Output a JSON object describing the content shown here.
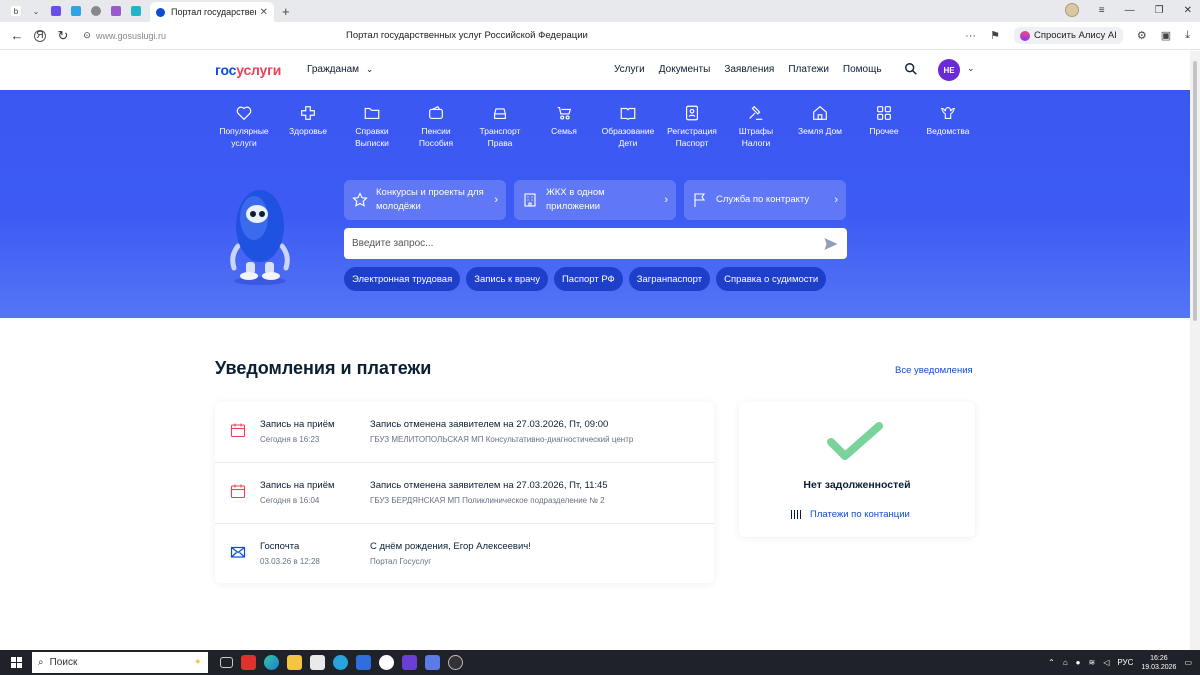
{
  "browser": {
    "active_tab_title": "Портал государственн",
    "url": "www.gosuslugi.ru",
    "page_title": "Портал государственных услуг Российской Федерации",
    "alice_label": "Спросить Алису AI",
    "more_dots": "···"
  },
  "header": {
    "logo_part1": "гос",
    "logo_part2": "услуги",
    "persona": "Гражданам",
    "nav": [
      "Услуги",
      "Документы",
      "Заявления",
      "Платежи",
      "Помощь"
    ],
    "avatar_initials": "НЕ"
  },
  "categories": [
    {
      "label": "Популярные услуги",
      "icon": "heart-icon"
    },
    {
      "label": "Здоровье",
      "icon": "health-cross-icon"
    },
    {
      "label": "Справки Выписки",
      "icon": "folder-icon"
    },
    {
      "label": "Пенсии Пособия",
      "icon": "wallet-icon"
    },
    {
      "label": "Транспорт Права",
      "icon": "car-icon"
    },
    {
      "label": "Семья",
      "icon": "stroller-icon"
    },
    {
      "label": "Образование Дети",
      "icon": "book-icon"
    },
    {
      "label": "Регистрация Паспорт",
      "icon": "id-card-icon"
    },
    {
      "label": "Штрафы Налоги",
      "icon": "gavel-icon"
    },
    {
      "label": "Земля Дом",
      "icon": "house-icon"
    },
    {
      "label": "Прочее",
      "icon": "grid-icon"
    },
    {
      "label": "Ведомства",
      "icon": "emblem-icon"
    }
  ],
  "promos": [
    {
      "label": "Конкурсы и проекты для молодёжи",
      "icon": "star-icon"
    },
    {
      "label": "ЖКХ в одном приложении",
      "icon": "building-icon"
    },
    {
      "label": "Служба по контракту",
      "icon": "flag-icon"
    }
  ],
  "search": {
    "placeholder": "Введите запрос..."
  },
  "quick_chips": [
    "Электронная трудовая",
    "Запись к врачу",
    "Паспорт РФ",
    "Загранпаспорт",
    "Справка о судимости"
  ],
  "notifications": {
    "title": "Уведомления и платежи",
    "all_link": "Все уведомления",
    "items": [
      {
        "type": "Запись на приём",
        "date": "Сегодня в 16:23",
        "text": "Запись отменена заявителем на 27.03.2026, Пт, 09:00",
        "source": "ГБУЗ МЕЛИТОПОЛЬСКАЯ МП Консультативно-диагностический центр",
        "icon": "calendar-icon"
      },
      {
        "type": "Запись на приём",
        "date": "Сегодня в 16:04",
        "text": "Запись отменена заявителем на 27.03.2026, Пт, 11:45",
        "source": "ГБУЗ БЕРДЯНСКАЯ МП Поликлиническое подразделение № 2",
        "icon": "calendar-icon"
      },
      {
        "type": "Госпочта",
        "date": "03.03.26 в 12:28",
        "text": "С днём рождения, Егор Алексеевич!",
        "source": "Портал Госуслуг",
        "icon": "envelope-icon"
      }
    ]
  },
  "debts": {
    "status": "Нет задолженностей",
    "link": "Платежи по контанции"
  },
  "taskbar": {
    "search_label": "Поиск",
    "lang": "РУС",
    "time": "16:26",
    "date": "19.03.2026"
  },
  "colors": {
    "accent": "#0d4cd3",
    "hero": "#3d5bf4",
    "logo_red": "#ee3f58",
    "success": "#7ad39b"
  }
}
